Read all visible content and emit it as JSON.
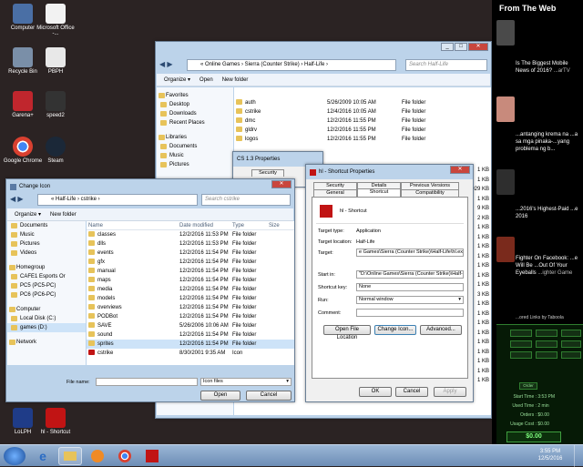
{
  "desktop": {
    "icons": [
      {
        "label": "Computer",
        "color": "#4a6fa5"
      },
      {
        "label": "Microsoft Office -...",
        "color": "#f2f2f2"
      },
      {
        "label": "Recycle Bin",
        "color": "#7a8fa8"
      },
      {
        "label": "PBPH",
        "color": "#e8e8e8"
      },
      {
        "label": "Garena+",
        "color": "#c0262d"
      },
      {
        "label": "speed2",
        "color": "#333333"
      },
      {
        "label": "Google Chrome",
        "color": "#d94030"
      },
      {
        "label": "Steam",
        "color": "#1b2838"
      },
      {
        "label": "LoLPH",
        "color": "#1f3c88"
      },
      {
        "label": "hl - Shortcut",
        "color": "#c11414"
      }
    ]
  },
  "explorer_back": {
    "address": "« Online Games › Sierra (Counter Strike) › Half-Life ›",
    "search_placeholder": "Search Half-Life",
    "cmd": {
      "organize": "Organize ▾",
      "open": "Open",
      "new_folder": "New folder"
    },
    "nav": [
      "Favorites",
      "Desktop",
      "Downloads",
      "Recent Places",
      "Libraries",
      "Documents",
      "Music",
      "Pictures"
    ],
    "files": [
      {
        "name": "auth",
        "date": "5/26/2009 10:05 AM",
        "type": "File folder"
      },
      {
        "name": "cstrike",
        "date": "12/4/2016 10:05 AM",
        "type": "File folder"
      },
      {
        "name": "dmc",
        "date": "12/2/2016 11:55 PM",
        "type": "File folder"
      },
      {
        "name": "gldrv",
        "date": "12/2/2016 11:55 PM",
        "type": "File folder"
      },
      {
        "name": "logos",
        "date": "12/2/2016 11:55 PM",
        "type": "File folder"
      }
    ],
    "sizes": [
      "1 KB",
      "1 KB",
      "929 KB",
      "1 KB",
      "9 KB",
      "2 KB",
      "1 KB",
      "1 KB",
      "1 KB",
      "1 KB",
      "1 KB",
      "1 KB",
      "1 KB",
      "3 KB",
      "1 KB",
      "1 KB",
      "1 KB",
      "1 KB",
      "1 KB",
      "1 KB",
      "1 KB",
      "1 KB",
      "1 KB"
    ]
  },
  "cs_properties": {
    "title": "CS 1.3 Properties",
    "tab": "Security"
  },
  "change_icon": {
    "title": "Change Icon",
    "address": "« Half-Life › cstrike ›",
    "search_placeholder": "Search cstrike",
    "cmd": {
      "organize": "Organize ▾",
      "new_folder": "New folder"
    },
    "nav": [
      "Documents",
      "Music",
      "Pictures",
      "Videos",
      "Homegroup",
      "CAFE1 Esports Or",
      "PC5 (PC5-PC)",
      "PC6 (PC6-PC)",
      "Computer",
      "Local Disk (C:)",
      "games (D:)",
      "Network"
    ],
    "columns": {
      "name": "Name",
      "date": "Date modified",
      "type": "Type",
      "size": "Size"
    },
    "files": [
      {
        "name": "classes",
        "date": "12/2/2016 11:53 PM",
        "type": "File folder"
      },
      {
        "name": "dlls",
        "date": "12/2/2016 11:53 PM",
        "type": "File folder"
      },
      {
        "name": "events",
        "date": "12/2/2016 11:54 PM",
        "type": "File folder"
      },
      {
        "name": "gfx",
        "date": "12/2/2016 11:54 PM",
        "type": "File folder"
      },
      {
        "name": "manual",
        "date": "12/2/2016 11:54 PM",
        "type": "File folder"
      },
      {
        "name": "maps",
        "date": "12/2/2016 11:54 PM",
        "type": "File folder"
      },
      {
        "name": "media",
        "date": "12/2/2016 11:54 PM",
        "type": "File folder"
      },
      {
        "name": "models",
        "date": "12/2/2016 11:54 PM",
        "type": "File folder"
      },
      {
        "name": "overviews",
        "date": "12/2/2016 11:54 PM",
        "type": "File folder"
      },
      {
        "name": "PODBot",
        "date": "12/2/2016 11:54 PM",
        "type": "File folder"
      },
      {
        "name": "SAVE",
        "date": "5/26/2006 10:06 AM",
        "type": "File folder"
      },
      {
        "name": "sound",
        "date": "12/2/2016 11:54 PM",
        "type": "File folder"
      },
      {
        "name": "sprites",
        "date": "12/2/2016 11:54 PM",
        "type": "File folder"
      },
      {
        "name": "cstrike",
        "date": "8/30/2001 9:35 AM",
        "type": "Icon"
      }
    ],
    "file_name_label": "File name:",
    "filter": "Icon files",
    "open": "Open",
    "cancel": "Cancel"
  },
  "shortcut_props": {
    "title": "hl - Shortcut Properties",
    "tabs_row1": [
      "Security",
      "Details",
      "Previous Versions"
    ],
    "tabs_row2": [
      "General",
      "Shortcut",
      "Compatibility"
    ],
    "name": "hl - Shortcut",
    "target_type_label": "Target type:",
    "target_type": "Application",
    "target_location_label": "Target location:",
    "target_location": "Half-Life",
    "target_label": "Target:",
    "target": "e Games\\Sierra (Counter Strike)\\Half-Life\\hl.exe\"",
    "start_in_label": "Start in:",
    "start_in": "\"D:\\Online Games\\Sierra (Counter Strike)\\Half-Lif",
    "shortcut_key_label": "Shortcut key:",
    "shortcut_key": "None",
    "run_label": "Run:",
    "run": "Normal window",
    "comment_label": "Comment:",
    "open_file_location": "Open File Location",
    "change_icon": "Change Icon...",
    "advanced": "Advanced...",
    "ok": "OK",
    "cancel": "Cancel",
    "apply": "Apply"
  },
  "web_panel": {
    "header": "From The Web",
    "items": [
      {
        "text": "Is The Biggest Mobile News of 2016?",
        "sub": "...arTV",
        "color": "#4a4a4a"
      },
      {
        "text": "...antanging krema na ...a sa mga pinaka-...yang problema ng b...",
        "sub": "",
        "color": "#c88a7c"
      },
      {
        "text": "...2016's Highest-Paid ...e 2016",
        "sub": "",
        "color": "#2e2e2e"
      },
      {
        "text": "Fighter On Facebook: ...e Will Be ...Out Of Your Eyeballs",
        "sub": "...ighter Game",
        "color": "#7a2a1c"
      }
    ],
    "sponsored": "...ored Links by Taboola",
    "hud": {
      "time_label": "Start Time :",
      "time": "3:53 PM",
      "used_label": "Used Time :",
      "used": "2 min",
      "orders_label": "Orders :",
      "orders": "$0.00",
      "usage_label": "Usage Cost :",
      "usage": "$0.00",
      "total": "$0.00",
      "tabs": [
        "Order"
      ]
    }
  },
  "taskbar": {
    "time": "3:55 PM",
    "date": "12/5/2016"
  }
}
